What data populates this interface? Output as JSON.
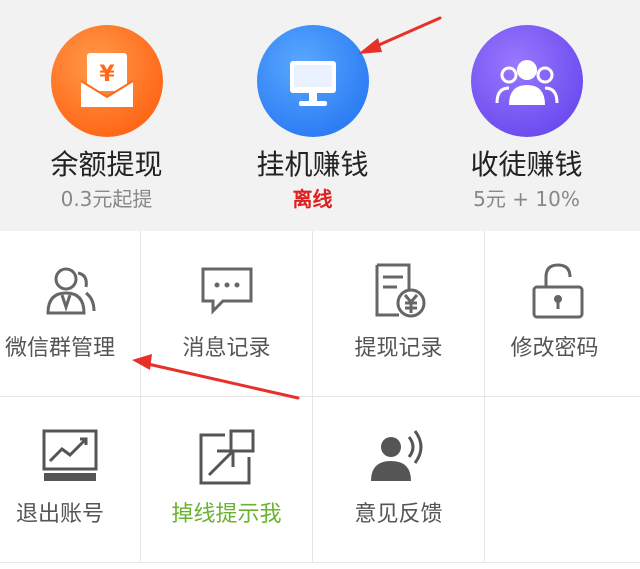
{
  "features": [
    {
      "title": "余额提现",
      "subtitle": "0.3元起提",
      "icon": "yuan-envelope-icon",
      "color": "#ff6a1a"
    },
    {
      "title": "挂机赚钱",
      "subtitle": "离线",
      "icon": "monitor-icon",
      "color": "#2f7ff5",
      "subtitle_color": "#e02020"
    },
    {
      "title": "收徒赚钱",
      "subtitle": "5元 + 10%",
      "icon": "group-icon",
      "color": "#6f4ff0"
    }
  ],
  "menu": [
    {
      "label": "微信群管理",
      "icon": "contacts-icon"
    },
    {
      "label": "消息记录",
      "icon": "chat-bubble-icon"
    },
    {
      "label": "提现记录",
      "icon": "receipt-yuan-icon"
    },
    {
      "label": "修改密码",
      "icon": "lock-icon"
    },
    {
      "label": "退出账号",
      "icon": "chart-monitor-icon"
    },
    {
      "label": "掉线提示我",
      "icon": "external-link-icon",
      "label_color": "#6ab22f"
    },
    {
      "label": "意见反馈",
      "icon": "speaker-person-icon"
    }
  ],
  "annotation_color": "#e8302a"
}
